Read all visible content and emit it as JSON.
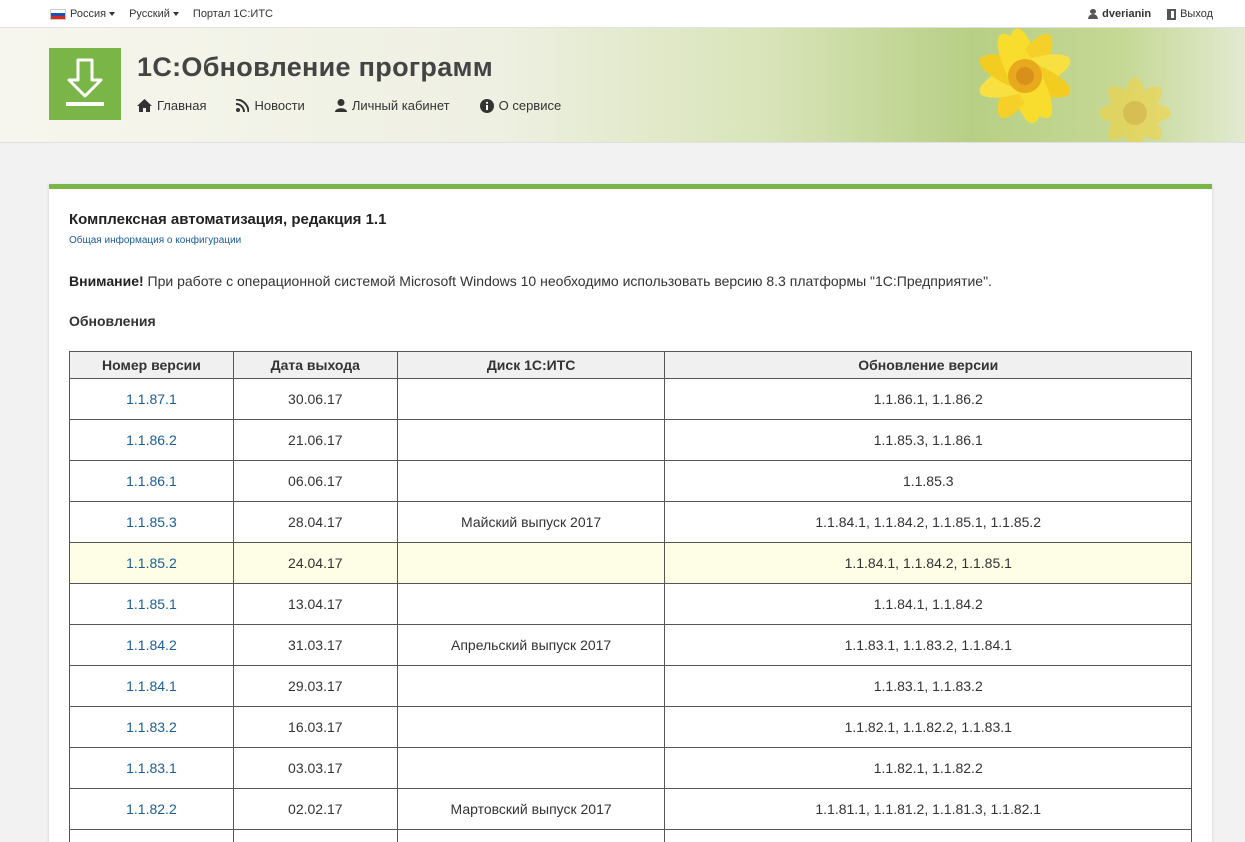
{
  "topbar": {
    "country": "Россия",
    "language": "Русский",
    "portal": "Портал 1С:ИТС",
    "username": "dverianin",
    "logout": "Выход"
  },
  "header": {
    "title": "1С:Обновление программ",
    "nav": {
      "home": "Главная",
      "news": "Новости",
      "account": "Личный кабинет",
      "about": "О сервисе"
    }
  },
  "colors": {
    "accent": "#7ab547",
    "link": "#1a5d96",
    "highlight_row": "#fefde6"
  },
  "config": {
    "title": "Комплексная автоматизация, редакция 1.1",
    "info_link": "Общая информация о конфигурации",
    "warning_label": "Внимание!",
    "warning_text": " При работе с операционной системой Microsoft Windows 10 необходимо использовать версию 8.3 платформы \"1С:Предприятие\".",
    "section": "Обновления"
  },
  "table": {
    "headers": {
      "version": "Номер версии",
      "date": "Дата выхода",
      "disk": "Диск 1С:ИТС",
      "update": "Обновление версии"
    },
    "rows": [
      {
        "version": "1.1.87.1",
        "date": "30.06.17",
        "disk": "",
        "update": "1.1.86.1, 1.1.86.2"
      },
      {
        "version": "1.1.86.2",
        "date": "21.06.17",
        "disk": "",
        "update": "1.1.85.3, 1.1.86.1"
      },
      {
        "version": "1.1.86.1",
        "date": "06.06.17",
        "disk": "",
        "update": "1.1.85.3"
      },
      {
        "version": "1.1.85.3",
        "date": "28.04.17",
        "disk": "Майский выпуск 2017",
        "update": "1.1.84.1, 1.1.84.2, 1.1.85.1, 1.1.85.2"
      },
      {
        "version": "1.1.85.2",
        "date": "24.04.17",
        "disk": "",
        "update": "1.1.84.1, 1.1.84.2, 1.1.85.1"
      },
      {
        "version": "1.1.85.1",
        "date": "13.04.17",
        "disk": "",
        "update": "1.1.84.1, 1.1.84.2"
      },
      {
        "version": "1.1.84.2",
        "date": "31.03.17",
        "disk": "Апрельский выпуск 2017",
        "update": "1.1.83.1, 1.1.83.2, 1.1.84.1"
      },
      {
        "version": "1.1.84.1",
        "date": "29.03.17",
        "disk": "",
        "update": "1.1.83.1, 1.1.83.2"
      },
      {
        "version": "1.1.83.2",
        "date": "16.03.17",
        "disk": "",
        "update": "1.1.82.1, 1.1.82.2, 1.1.83.1"
      },
      {
        "version": "1.1.83.1",
        "date": "03.03.17",
        "disk": "",
        "update": "1.1.82.1, 1.1.82.2"
      },
      {
        "version": "1.1.82.2",
        "date": "02.02.17",
        "disk": "Мартовский выпуск 2017",
        "update": "1.1.81.1, 1.1.81.2, 1.1.81.3, 1.1.82.1"
      },
      {
        "version": "",
        "date": "",
        "disk": "",
        "update": ""
      }
    ]
  }
}
